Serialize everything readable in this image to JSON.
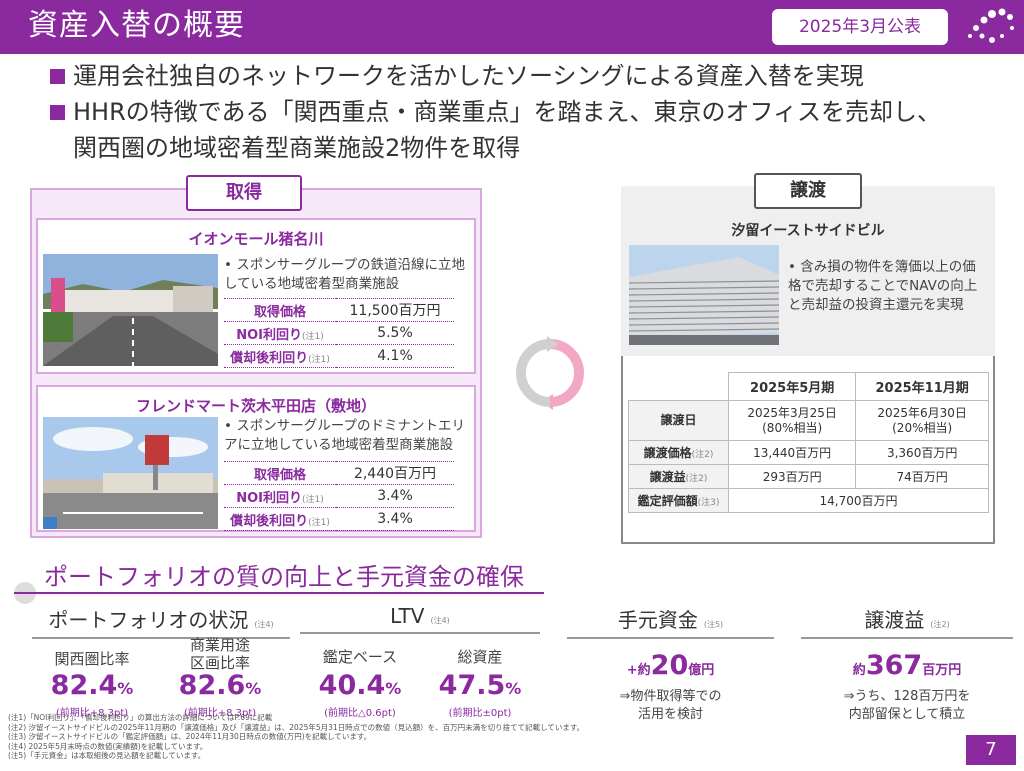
{
  "header": {
    "title": "資産入替の概要",
    "date": "2025年3月公表"
  },
  "bullets": {
    "line1": "運用会社独自のネットワークを活かしたソーシングによる資産入替を実現",
    "line2": "HHRの特徴である「関西重点・商業重点」を踏まえ、東京のオフィスを売却し、",
    "line2b": "関西圏の地域密着型商業施設2物件を取得"
  },
  "acquisition": {
    "tag": "取得",
    "properties": [
      {
        "name": "イオンモール猪名川",
        "desc": "• スポンサーグループの鉄道沿線に立地している地域密着型商業施設",
        "rows": [
          {
            "label": "取得価格",
            "note": "",
            "value": "11,500百万円"
          },
          {
            "label": "NOI利回り",
            "note": "(注1)",
            "value": "5.5%"
          },
          {
            "label": "償却後利回り",
            "note": "(注1)",
            "value": "4.1%"
          }
        ]
      },
      {
        "name": "フレンドマート茨木平田店（敷地）",
        "desc": "• スポンサーグループのドミナントエリアに立地している地域密着型商業施設",
        "rows": [
          {
            "label": "取得価格",
            "note": "",
            "value": "2,440百万円"
          },
          {
            "label": "NOI利回り",
            "note": "(注1)",
            "value": "3.4%"
          },
          {
            "label": "償却後利回り",
            "note": "(注1)",
            "value": "3.4%"
          }
        ]
      }
    ]
  },
  "transfer": {
    "tag": "譲渡",
    "name": "汐留イーストサイドビル",
    "desc": "• 含み損の物件を簿価以上の価格で売却することでNAVの向上と売却益の投資主還元を実現",
    "col1": "2025年5月期",
    "col2": "2025年11月期",
    "rows": {
      "date": {
        "label": "譲渡日",
        "v1a": "2025年3月25日",
        "v1b": "(80%相当)",
        "v2a": "2025年6月30日",
        "v2b": "(20%相当)"
      },
      "price": {
        "label": "譲渡価格",
        "note": "(注2)",
        "v1": "13,440百万円",
        "v2": "3,360百万円"
      },
      "gain": {
        "label": "譲渡益",
        "note": "(注2)",
        "v1": "293百万円",
        "v2": "74百万円"
      },
      "appraisal": {
        "label": "鑑定評価額",
        "note": "(注3)",
        "v": "14,700百万円"
      }
    }
  },
  "section": {
    "title": "ポートフォリオの質の向上と手元資金の確保"
  },
  "metrics": {
    "portfolio": {
      "head": "ポートフォリオの状況",
      "note": "(注4)",
      "kansai": {
        "label": "関西圏比率",
        "value": "82.4",
        "unit": "%",
        "sub": "(前期比+8.3pt)"
      },
      "commercial": {
        "label1": "商業用途",
        "label2": "区画比率",
        "value": "82.6",
        "unit": "%",
        "sub": "(前期比+8.3pt)"
      }
    },
    "ltv": {
      "head": "LTV",
      "note": "(注4)",
      "appraisal": {
        "label": "鑑定ベース",
        "value": "40.4",
        "unit": "%",
        "sub": "(前期比△0.6pt)"
      },
      "total": {
        "label": "総資産",
        "value": "47.5",
        "unit": "%",
        "sub": "(前期比±0pt)"
      }
    },
    "cash": {
      "head": "手元資金",
      "note": "(注5)",
      "prefix": "+約",
      "value": "20",
      "unit": "億円",
      "desc1": "⇒物件取得等での",
      "desc2": "活用を検討"
    },
    "gain": {
      "head": "譲渡益",
      "note": "(注2)",
      "prefix": "約",
      "value": "367",
      "unit": "百万円",
      "desc1": "⇒うち、128百万円を",
      "desc2": "内部留保として積立"
    }
  },
  "notes": [
    "(注1)「NOI利回り」、「償却後利回り」の算出方法の詳細についてはP.69に記載",
    "(注2) 汐留イーストサイドビルの2025年11月期の「譲渡価格」及び「譲渡益」は、2025年5月31日時点での数値（見込額）を、百万円未満を切り捨てて記載しています。",
    "(注3) 汐留イーストサイドビルの「鑑定評価額」は、2024年11月30日時点の数値(万円)を記載しています。",
    "(注4) 2025年5月末時点の数値(実績額)を記載しています。",
    "(注5)「手元資金」は本取組後の見込額を記載しています。"
  ],
  "page": "7"
}
